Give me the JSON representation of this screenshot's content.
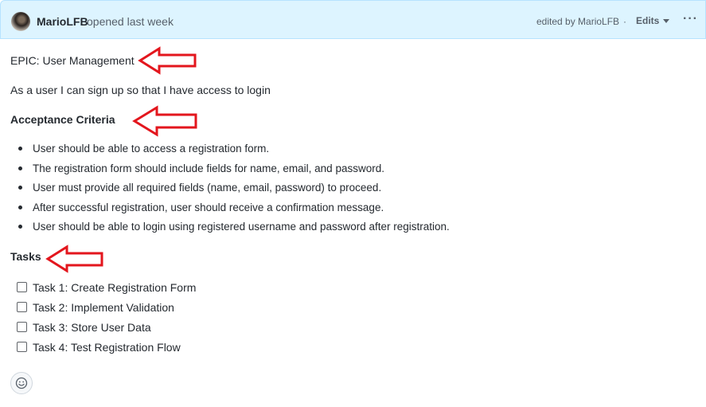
{
  "header": {
    "author": "MarioLFB",
    "opened_text": "opened last week",
    "edited_text": "edited by MarioLFB",
    "separator": "·",
    "edits_label": "Edits",
    "more_label": "···"
  },
  "body": {
    "epic": "EPIC: User Management",
    "story": "As a user I can sign up so that I have access to login",
    "acceptance_heading": "Acceptance Criteria",
    "acceptance_items": [
      "User should be able to access a registration form.",
      "The registration form should include fields for name, email, and password.",
      "User must provide all required fields (name, email, password) to proceed.",
      "After successful registration, user should receive a confirmation message.",
      "User should be able to login using registered username and password after registration."
    ],
    "tasks_heading": "Tasks",
    "tasks": [
      {
        "label": "Task 1: Create Registration Form",
        "checked": false
      },
      {
        "label": "Task 2: Implement Validation",
        "checked": false
      },
      {
        "label": "Task 3: Store User Data",
        "checked": false
      },
      {
        "label": "Task 4: Test Registration Flow",
        "checked": false
      }
    ]
  },
  "icons": {
    "reaction": "smiley-icon",
    "annotation": "red-arrow-icon"
  },
  "colors": {
    "header_bg": "#ddf4ff",
    "arrow": "#e3161d"
  }
}
